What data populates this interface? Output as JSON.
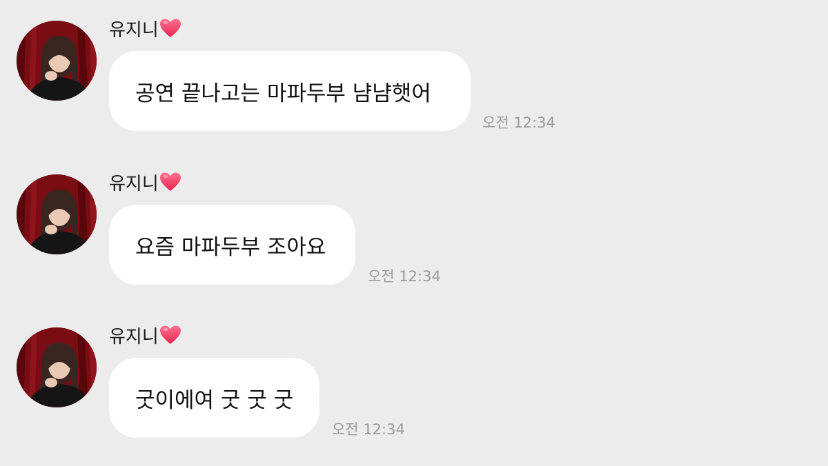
{
  "colors": {
    "background": "#ececec",
    "bubble": "#ffffff",
    "timestamp": "#9a9a9a",
    "heart": "#f0446a"
  },
  "messages": [
    {
      "sender": "유지니",
      "sender_icon": "heart-icon",
      "text": "공연 끝나고는 마파두부 냠냠햇어",
      "time": "오전 12:34"
    },
    {
      "sender": "유지니",
      "sender_icon": "heart-icon",
      "text": "요즘 마파두부 조아요",
      "time": "오전 12:34"
    },
    {
      "sender": "유지니",
      "sender_icon": "heart-icon",
      "text": "굿이에여 굿 굿 굿",
      "time": "오전 12:34"
    }
  ]
}
